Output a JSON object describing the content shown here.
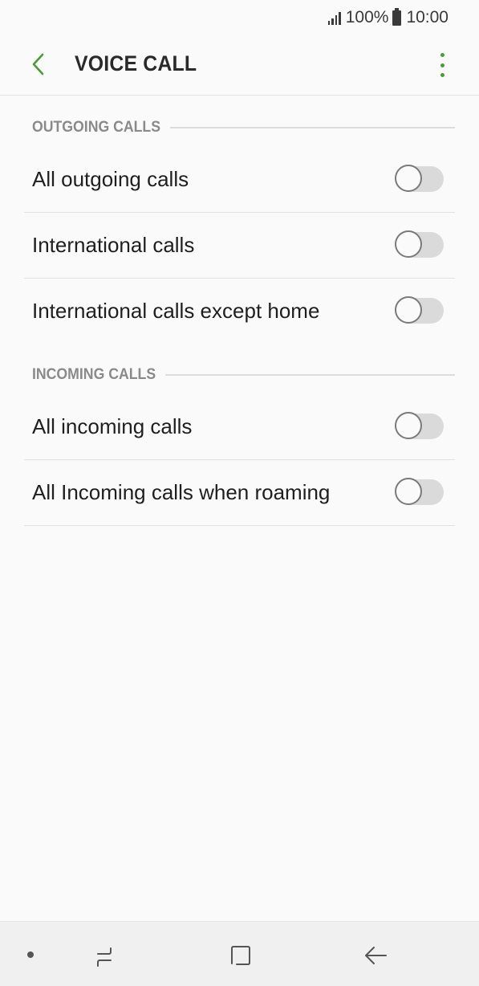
{
  "status_bar": {
    "battery_text": "100%",
    "time": "10:00",
    "icons": [
      "signal-icon",
      "battery-icon"
    ]
  },
  "app_bar": {
    "title": "VOICE CALL",
    "back_icon": "back-arrow-icon",
    "more_icon": "more-options-icon",
    "accent_color": "#4d9a3a"
  },
  "sections": {
    "outgoing": {
      "header": "OUTGOING CALLS",
      "items": [
        {
          "label": "All outgoing calls",
          "enabled": false
        },
        {
          "label": "International calls",
          "enabled": false
        },
        {
          "label": "International calls except home",
          "enabled": false
        }
      ]
    },
    "incoming": {
      "header": "INCOMING CALLS",
      "items": [
        {
          "label": "All incoming calls",
          "enabled": false
        },
        {
          "label": "All Incoming calls when roaming",
          "enabled": false
        }
      ]
    }
  },
  "nav_bar": {
    "icons": [
      "recent-apps-icon",
      "home-icon",
      "back-icon"
    ]
  }
}
